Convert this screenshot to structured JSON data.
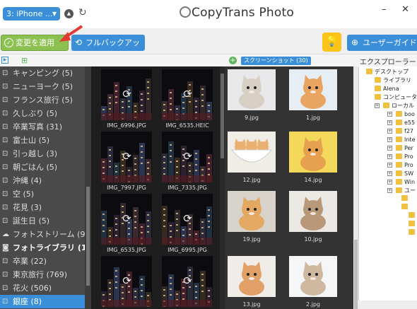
{
  "app": {
    "title": "CopyTrans Photo"
  },
  "topbar": {
    "device": "3: iPhone ...",
    "minimize": "–",
    "close": "✕"
  },
  "toolbar": {
    "apply_label": "変更を適用",
    "backup_label": "フルバックアップ",
    "guide_label": "ユーザーガイド"
  },
  "albums": [
    {
      "label": "キャンピング (5)",
      "icon": "album-icon"
    },
    {
      "label": "ニューヨーク (5)",
      "icon": "album-icon"
    },
    {
      "label": "フランス旅行 (5)",
      "icon": "album-icon"
    },
    {
      "label": "久しぶり (5)",
      "icon": "album-icon"
    },
    {
      "label": "卒業写真 (31)",
      "icon": "album-icon"
    },
    {
      "label": "富士山 (5)",
      "icon": "album-icon"
    },
    {
      "label": "引っ越し (3)",
      "icon": "album-icon"
    },
    {
      "label": "朝ごはん (5)",
      "icon": "album-icon"
    },
    {
      "label": "沖縄 (4)",
      "icon": "album-icon"
    },
    {
      "label": "空 (5)",
      "icon": "album-icon"
    },
    {
      "label": "花見 (3)",
      "icon": "album-icon"
    },
    {
      "label": "誕生日 (5)",
      "icon": "album-icon"
    },
    {
      "label": "フォトストリーム (9...",
      "icon": "cloud-icon"
    },
    {
      "label": "フォトライブラリ (142...",
      "icon": "camera-icon"
    },
    {
      "label": "卒業 (22)",
      "icon": "album-icon"
    },
    {
      "label": "東京旅行 (769)",
      "icon": "album-icon"
    },
    {
      "label": "花火 (506)",
      "icon": "album-icon"
    },
    {
      "label": "銀座 (8)",
      "icon": "album-icon"
    }
  ],
  "photos": [
    {
      "name": "IMG_6996.JPG"
    },
    {
      "name": "IMG_6535.HEIC"
    },
    {
      "name": "IMG_7997.JPG"
    },
    {
      "name": "IMG_7335.JPG"
    },
    {
      "name": "IMG_6535.JPG"
    },
    {
      "name": "IMG_6995.JPG"
    },
    {
      "name": ""
    },
    {
      "name": ""
    }
  ],
  "screenshots": {
    "tab_label": "スクリーンショット (30)",
    "items": [
      {
        "name": "9.jpg"
      },
      {
        "name": "1.jpg"
      },
      {
        "name": "12.jpg"
      },
      {
        "name": "14.jpg"
      },
      {
        "name": "19.jpg"
      },
      {
        "name": "10.jpg"
      },
      {
        "name": "13.jpg"
      },
      {
        "name": "2.jpg"
      }
    ]
  },
  "explorer": {
    "title": "エクスプローラー",
    "items": [
      {
        "label": "デスクトップ"
      },
      {
        "label": "ライブラリ"
      },
      {
        "label": "Alena"
      },
      {
        "label": "コンピュータ"
      },
      {
        "label": "ローカル"
      },
      {
        "label": "boo"
      },
      {
        "label": "e55"
      },
      {
        "label": "f27"
      },
      {
        "label": "Inte"
      },
      {
        "label": "Per"
      },
      {
        "label": "Pro"
      },
      {
        "label": "Pro"
      },
      {
        "label": "SW"
      },
      {
        "label": "Win"
      },
      {
        "label": "ユー"
      }
    ]
  },
  "colors": {
    "accent": "#3a8fd8",
    "apply": "#8cc152",
    "tips": "#fcc419",
    "arrow": "#e53935"
  }
}
